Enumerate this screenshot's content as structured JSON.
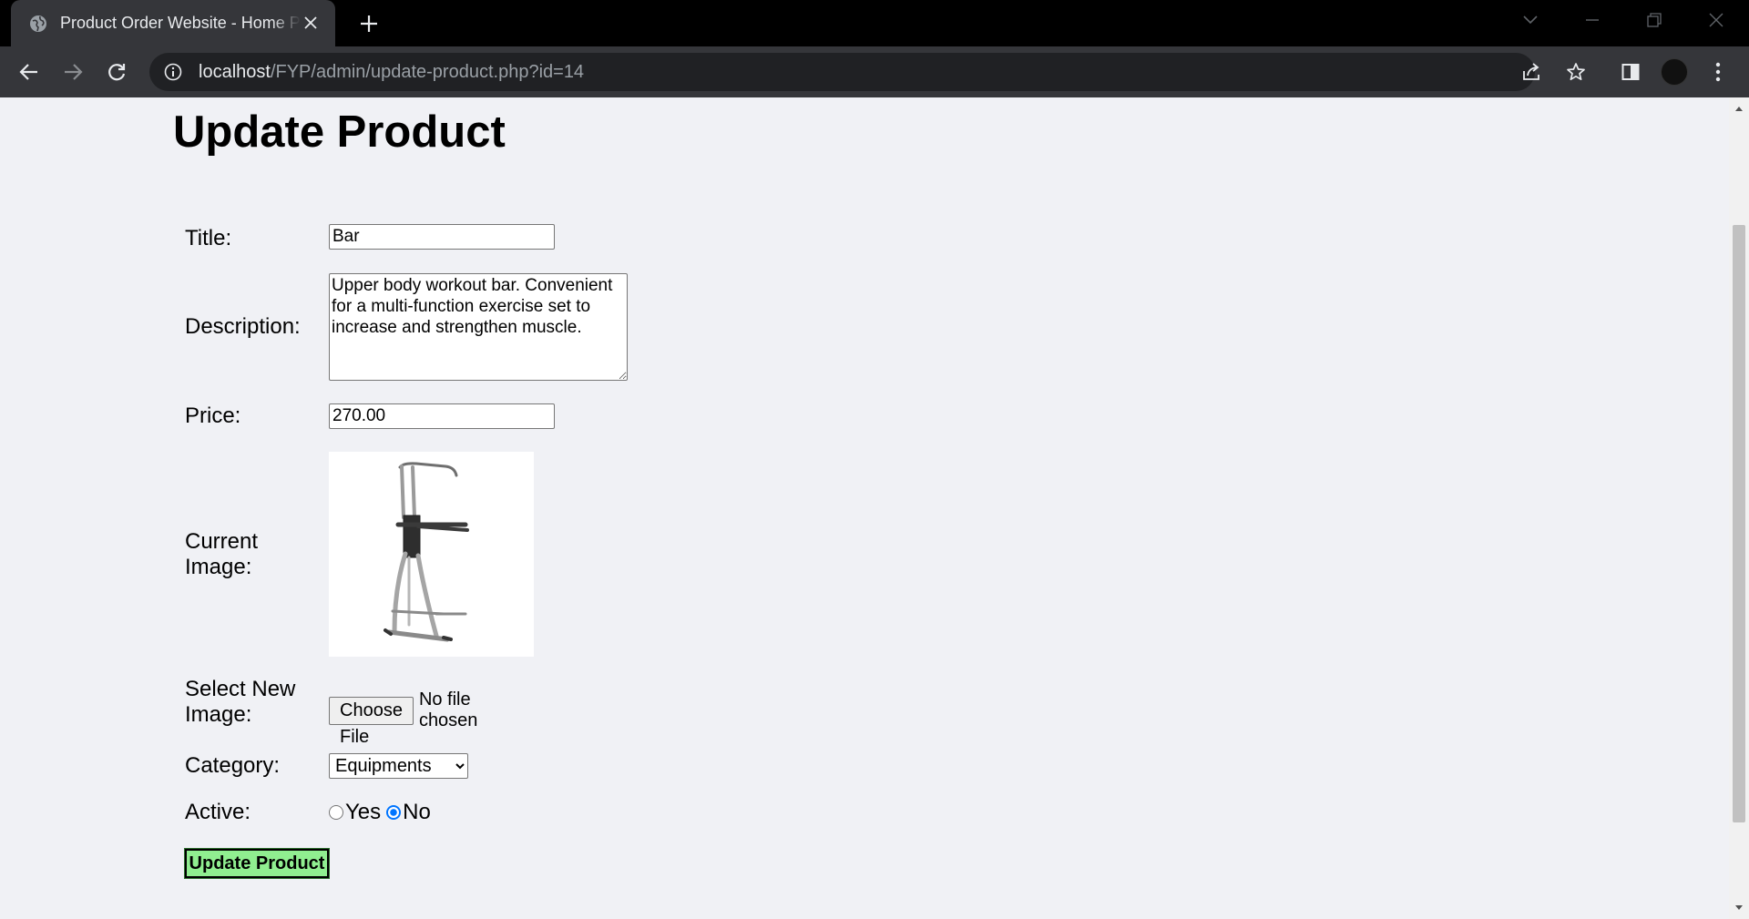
{
  "browser": {
    "tab_title": "Product Order Website - Home Page",
    "url_host": "localhost",
    "url_path": "/FYP/admin/update-product.php?id=14",
    "icons": [
      "globe-icon",
      "close-icon",
      "plus-icon",
      "chevron-down-icon",
      "minimize-icon",
      "restore-icon",
      "window-close-icon",
      "back-icon",
      "forward-icon",
      "reload-icon",
      "info-icon",
      "share-icon",
      "star-icon",
      "side-panel-icon",
      "profile-avatar",
      "kebab-menu-icon"
    ]
  },
  "page": {
    "title": "Update Product",
    "form": {
      "title_label": "Title:",
      "title_value": "Bar",
      "description_label": "Description:",
      "description_value": "Upper body workout bar. Convenient for a multi-function exercise set to increase and strengthen muscle.",
      "price_label": "Price:",
      "price_value": "270.00",
      "current_image_label": "Current Image:",
      "select_image_label": "Select New Image:",
      "file_button_label": "Choose File",
      "file_status": "No file chosen",
      "category_label": "Category:",
      "category_selected": "Equipments",
      "active_label": "Active:",
      "active_yes": "Yes",
      "active_no": "No",
      "active_selected": "No",
      "submit_label": "Update Product"
    }
  },
  "colors": {
    "submit_bg": "#90ee90",
    "page_bg": "#f0f1f5",
    "radio_checked": "#0075ff"
  }
}
